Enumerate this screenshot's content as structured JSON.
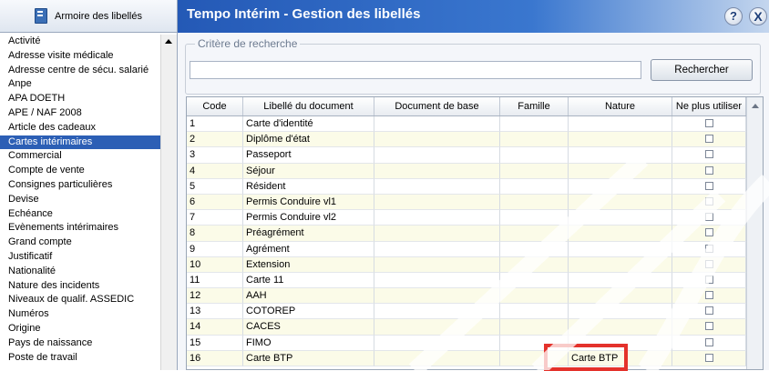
{
  "left_panel": {
    "header": "Armoire des libellés",
    "items": [
      "Activité",
      "Adresse visite médicale",
      "Adresse centre de sécu. salarié",
      "Anpe",
      "APA DOETH",
      "APE / NAF 2008",
      "Article des cadeaux",
      "Cartes intérimaires",
      "Commercial",
      "Compte de vente",
      "Consignes particulières",
      "Devise",
      "Echéance",
      "Evènements intérimaires",
      "Grand compte",
      "Justificatif",
      "Nationalité",
      "Nature des incidents",
      "Niveaux de qualif. ASSEDIC",
      "Numéros",
      "Origine",
      "Pays de naissance",
      "Poste de travail"
    ],
    "selected_index": 7
  },
  "window": {
    "title": "Tempo Intérim - Gestion des libellés",
    "help_label": "?",
    "close_label": "X"
  },
  "search": {
    "legend": "Critère de recherche",
    "value": "",
    "button_label": "Rechercher"
  },
  "grid": {
    "columns": [
      "Code",
      "Libellé du document",
      "Document de base",
      "Famille",
      "Nature",
      "Ne plus utiliser"
    ],
    "rows": [
      {
        "code": "1",
        "libelle": "Carte d'identité",
        "document": "",
        "famille": "",
        "nature": "",
        "ne_plus_utiliser": false
      },
      {
        "code": "2",
        "libelle": "Diplôme d'état",
        "document": "",
        "famille": "",
        "nature": "",
        "ne_plus_utiliser": false
      },
      {
        "code": "3",
        "libelle": "Passeport",
        "document": "",
        "famille": "",
        "nature": "",
        "ne_plus_utiliser": false
      },
      {
        "code": "4",
        "libelle": "Séjour",
        "document": "",
        "famille": "",
        "nature": "",
        "ne_plus_utiliser": false
      },
      {
        "code": "5",
        "libelle": "Résident",
        "document": "",
        "famille": "",
        "nature": "",
        "ne_plus_utiliser": false
      },
      {
        "code": "6",
        "libelle": "Permis Conduire vl1",
        "document": "",
        "famille": "",
        "nature": "",
        "ne_plus_utiliser": false
      },
      {
        "code": "7",
        "libelle": "Permis Conduire vl2",
        "document": "",
        "famille": "",
        "nature": "",
        "ne_plus_utiliser": false
      },
      {
        "code": "8",
        "libelle": "Préagrément",
        "document": "",
        "famille": "",
        "nature": "",
        "ne_plus_utiliser": false
      },
      {
        "code": "9",
        "libelle": "Agrément",
        "document": "",
        "famille": "",
        "nature": "",
        "ne_plus_utiliser": false
      },
      {
        "code": "10",
        "libelle": "Extension",
        "document": "",
        "famille": "",
        "nature": "",
        "ne_plus_utiliser": false
      },
      {
        "code": "11",
        "libelle": "Carte 11",
        "document": "",
        "famille": "",
        "nature": "",
        "ne_plus_utiliser": false
      },
      {
        "code": "12",
        "libelle": "AAH",
        "document": "",
        "famille": "",
        "nature": "",
        "ne_plus_utiliser": false
      },
      {
        "code": "13",
        "libelle": "COTOREP",
        "document": "",
        "famille": "",
        "nature": "",
        "ne_plus_utiliser": false
      },
      {
        "code": "14",
        "libelle": "CACES",
        "document": "",
        "famille": "",
        "nature": "",
        "ne_plus_utiliser": false
      },
      {
        "code": "15",
        "libelle": "FIMO",
        "document": "",
        "famille": "",
        "nature": "",
        "ne_plus_utiliser": false
      },
      {
        "code": "16",
        "libelle": "Carte BTP",
        "document": "",
        "famille": "",
        "nature": "Carte BTP",
        "ne_plus_utiliser": false
      }
    ]
  },
  "colors": {
    "title_bar": "#2459b6",
    "selection": "#2c5fb5",
    "row_alt": "#fbfbe8",
    "highlight_box": "#e4322b"
  }
}
